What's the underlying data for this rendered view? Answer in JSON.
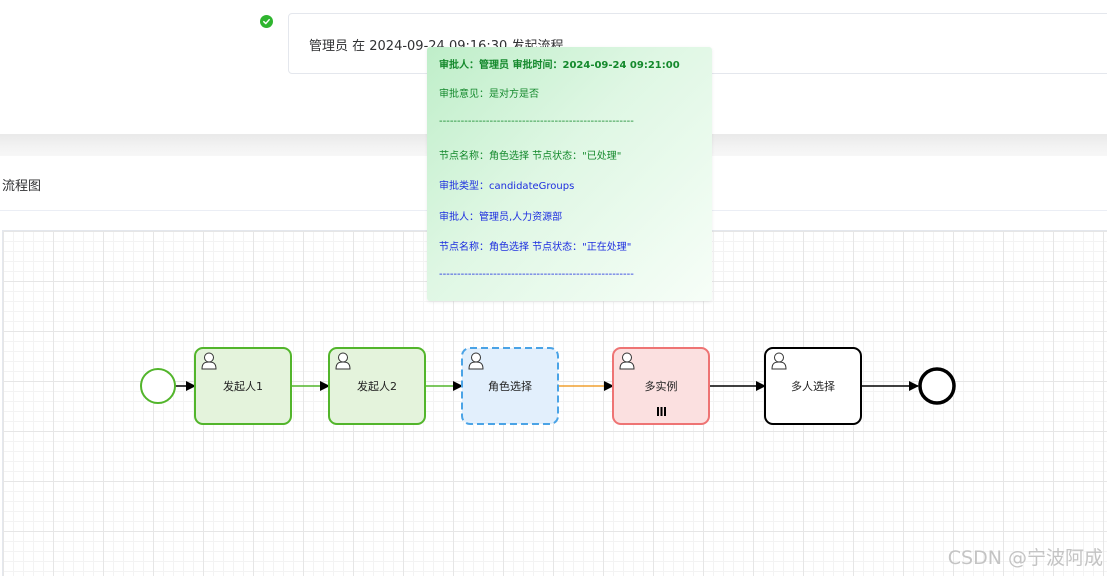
{
  "timeline": {
    "entry_text": "管理员 在 2024-09-24 09:16:30 发起流程"
  },
  "flow": {
    "title": "流程图",
    "tasks": [
      {
        "label": "发起人1",
        "status": "completed",
        "type": "user-task"
      },
      {
        "label": "发起人2",
        "status": "completed",
        "type": "user-task"
      },
      {
        "label": "角色选择",
        "status": "in-progress",
        "type": "user-task"
      },
      {
        "label": "多实例",
        "status": "rejected",
        "type": "multi-instance-user-task"
      },
      {
        "label": "多人选择",
        "status": "pending",
        "type": "user-task"
      }
    ],
    "colors": {
      "completed_stroke": "#52b52b",
      "completed_fill": "#e4f3dc",
      "active_stroke": "#4aa3e6",
      "active_fill": "#e2effc",
      "rejected_stroke": "#ee7474",
      "rejected_fill": "#fbe0e0",
      "pending_stroke": "#000000",
      "pending_fill": "#ffffff",
      "active_flow": "#f0a030"
    }
  },
  "tooltip": {
    "line1": "审批人：管理员 审批时间：2024-09-24 09:21:00",
    "line2": "审批意见：是对方是否",
    "separator1": "------------------------------------------------------",
    "line3": "节点名称：角色选择 节点状态：\"已处理\"",
    "line4": "审批类型：candidateGroups",
    "line5": "审批人：管理员,人力资源部",
    "line6": "节点名称：角色选择 节点状态：\"正在处理\"",
    "separator2": "------------------------------------------------------"
  },
  "watermark": "CSDN @宁波阿成"
}
